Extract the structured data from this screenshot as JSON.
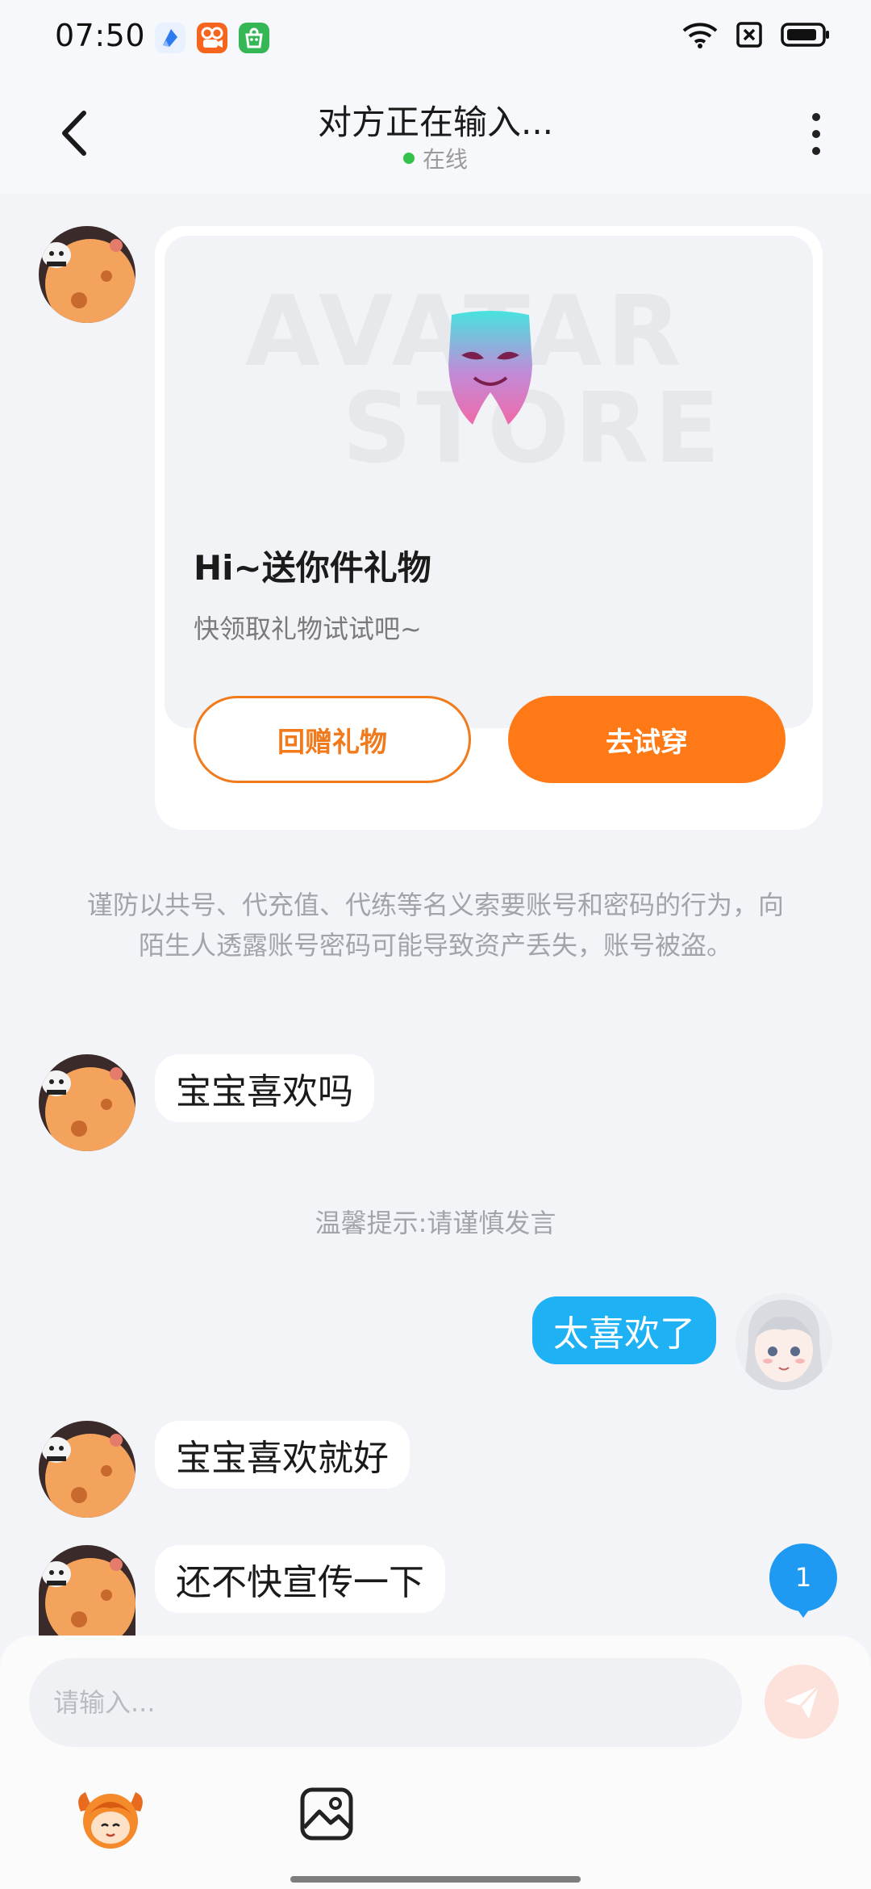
{
  "status_bar": {
    "time": "07:50",
    "notification_icons": [
      "browser-app-icon",
      "video-app-icon",
      "store-app-icon"
    ],
    "system_icons": [
      "wifi-icon",
      "sim-icon",
      "battery-icon"
    ]
  },
  "header": {
    "title": "对方正在输入...",
    "status": "在线"
  },
  "gift_card": {
    "banner_watermark_line1": "AVATAR",
    "banner_watermark_line2": "STORE",
    "title": "Hi~送你件礼物",
    "subtitle": "快领取礼物试试吧~",
    "return_gift_label": "回赠礼物",
    "try_on_label": "去试穿"
  },
  "notices": {
    "security_warning": "谨防以共号、代充值、代练等名义索要账号和密码的行为，向陌生人透露账号密码可能导致资产丢失，账号被盗。",
    "tip": "温馨提示:请谨慎发言"
  },
  "messages": [
    {
      "sender": "other",
      "text": "宝宝喜欢吗"
    },
    {
      "sender": "me",
      "text": "太喜欢了"
    },
    {
      "sender": "other",
      "text": "宝宝喜欢就好"
    },
    {
      "sender": "other",
      "text": "还不快宣传一下"
    }
  ],
  "unread_count": "1",
  "input": {
    "placeholder": "请输入..."
  },
  "colors": {
    "accent_orange": "#ff7a17",
    "my_bubble": "#1eb1f4",
    "online": "#35c24a"
  }
}
